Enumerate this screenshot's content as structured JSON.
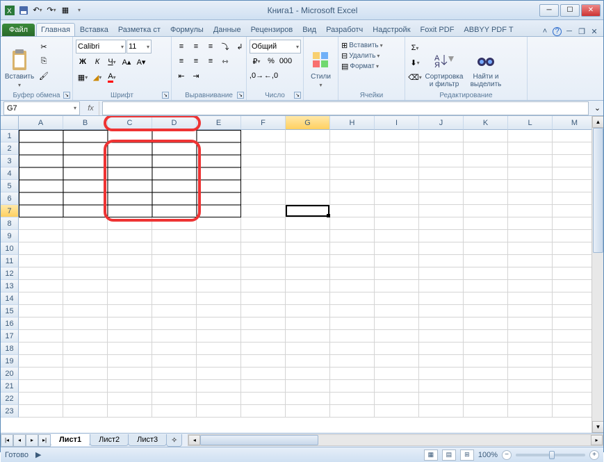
{
  "title": "Книга1  -  Microsoft Excel",
  "tabs": {
    "file": "Файл",
    "items": [
      "Главная",
      "Вставка",
      "Разметка ст",
      "Формулы",
      "Данные",
      "Рецензиров",
      "Вид",
      "Разработч",
      "Надстройк",
      "Foxit PDF",
      "ABBYY PDF T"
    ],
    "active_index": 0
  },
  "ribbon": {
    "clipboard": {
      "paste": "Вставить",
      "label": "Буфер обмена"
    },
    "font": {
      "name": "Calibri",
      "size": "11",
      "label": "Шрифт"
    },
    "alignment": {
      "label": "Выравнивание"
    },
    "number": {
      "format": "Общий",
      "label": "Число"
    },
    "styles": {
      "btn": "Стили",
      "label": ""
    },
    "cells": {
      "insert": "Вставить",
      "delete": "Удалить",
      "format": "Формат",
      "label": "Ячейки"
    },
    "editing": {
      "sort": "Сортировка и фильтр",
      "find": "Найти и выделить",
      "label": "Редактирование"
    }
  },
  "name_box": "G7",
  "columns": [
    "A",
    "B",
    "C",
    "D",
    "E",
    "F",
    "G",
    "H",
    "I",
    "J",
    "K",
    "L",
    "M"
  ],
  "rows": [
    "1",
    "2",
    "3",
    "4",
    "5",
    "6",
    "7",
    "8",
    "9",
    "10",
    "11",
    "12",
    "13",
    "14",
    "15",
    "16",
    "17",
    "18",
    "19",
    "20",
    "21",
    "22",
    "23"
  ],
  "active_col": "G",
  "active_row": "7",
  "sheets": {
    "items": [
      "Лист1",
      "Лист2",
      "Лист3"
    ],
    "active_index": 0
  },
  "status": {
    "ready": "Готово",
    "zoom": "100%"
  }
}
